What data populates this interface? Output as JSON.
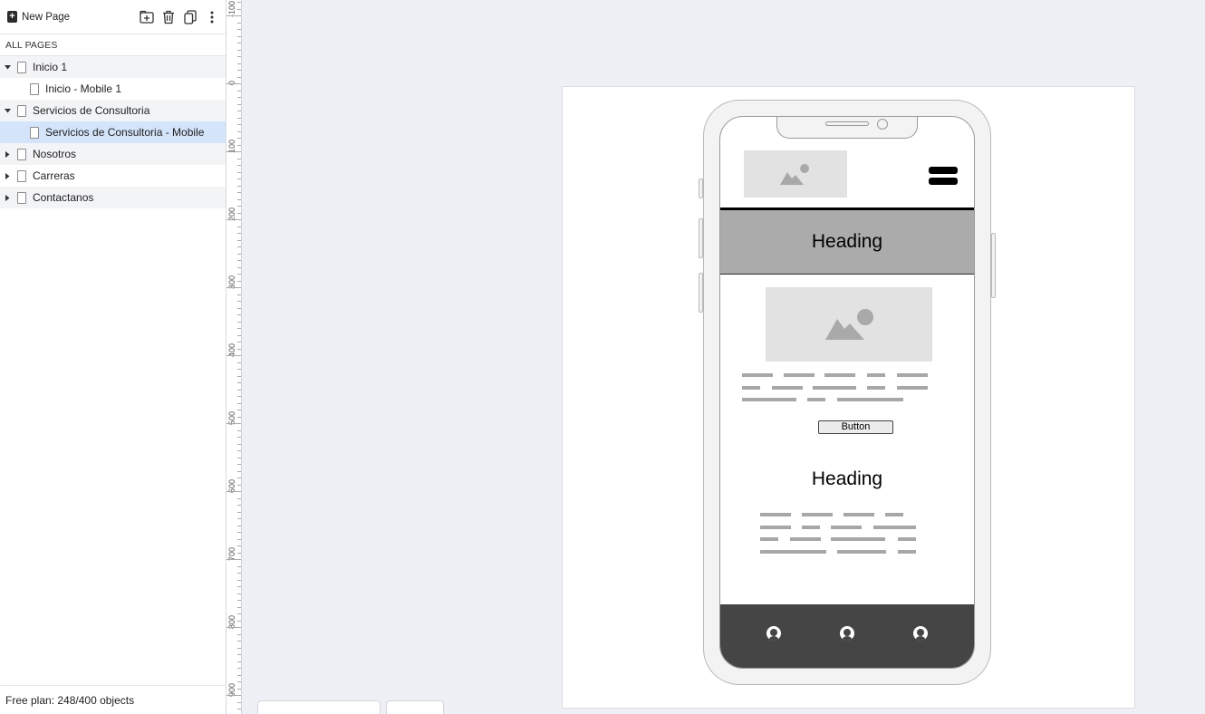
{
  "toolbar": {
    "new_page_label": "New Page",
    "icons": [
      "add-page-icon",
      "trash-icon",
      "duplicate-icon",
      "more-vertical-icon"
    ]
  },
  "sidebar": {
    "section_label": "ALL PAGES",
    "pages": [
      {
        "label": "Inicio 1",
        "level": 0,
        "expanded": true
      },
      {
        "label": "Inicio - Mobile 1",
        "level": 1
      },
      {
        "label": "Servicios de Consultoria",
        "level": 0,
        "expanded": true
      },
      {
        "label": "Servicios de Consultoria - Mobile",
        "level": 1,
        "selected": true
      },
      {
        "label": "Nosotros",
        "level": 0,
        "expanded": false
      },
      {
        "label": "Carreras",
        "level": 0,
        "expanded": false
      },
      {
        "label": "Contactanos",
        "level": 0,
        "expanded": false
      }
    ],
    "footer": "Free plan: 248/400 objects"
  },
  "ruler": {
    "labels": [
      "-100",
      "0",
      "100",
      "200",
      "300",
      "400",
      "500",
      "600",
      "700",
      "800",
      "900"
    ]
  },
  "mockup": {
    "hero_heading": "Heading",
    "button_label": "Button",
    "section_heading": "Heading"
  },
  "colors": {
    "selection": "#d4e4fb",
    "hero_bg": "#ababab",
    "bottom_nav": "#454545",
    "canvas_bg": "#eef0f5"
  }
}
